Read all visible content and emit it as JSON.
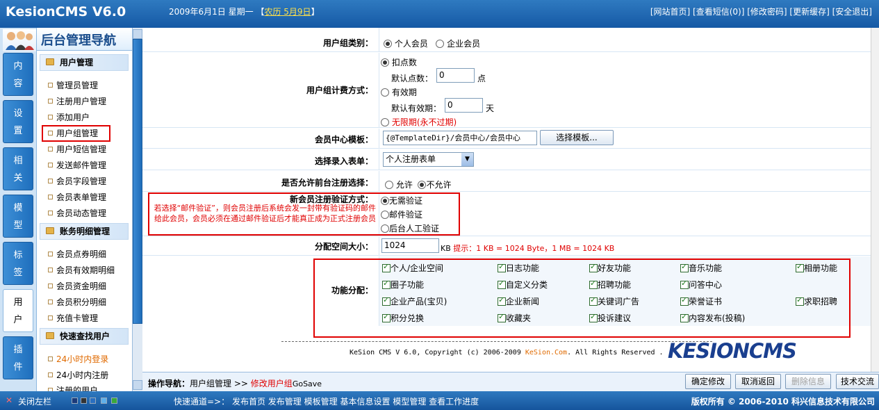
{
  "header": {
    "logo": "KesionCMS V6.0",
    "date": "2009年6月1日 星期一",
    "lunar_prefix": "【",
    "lunar": "农历 5月9日",
    "lunar_suffix": "】",
    "links": [
      "[网站首页]",
      "[查看短信(0)]",
      "[修改密码]",
      "[更新缓存]",
      "[安全退出]"
    ]
  },
  "left_tabs": [
    "内\n容",
    "设\n置",
    "相\n关",
    "模\n型",
    "标\n签",
    "用\n户",
    "插\n件"
  ],
  "nav": {
    "title": "后台管理导航",
    "section1": "用户管理",
    "items1": [
      "管理员管理",
      "注册用户管理",
      "添加用户",
      "用户组管理",
      "用户短信管理",
      "发送邮件管理",
      "会员字段管理",
      "会员表单管理",
      "会员动态管理"
    ],
    "section2": "账务明细管理",
    "items2": [
      "会员点券明细",
      "会员有效期明细",
      "会员资金明细",
      "会员积分明细",
      "充值卡管理"
    ],
    "section3": "快速查找用户",
    "items3": [
      "24小时内登录",
      "24小时内注册",
      "注册的用户"
    ]
  },
  "form": {
    "group_type_label": "用户组类别：",
    "group_type_opt1": "个人会员",
    "group_type_opt2": "企业会员",
    "billing_label": "用户组计费方式：",
    "billing_opt1": "扣点数",
    "default_points_label": "默认点数：",
    "default_points_value": "0",
    "points_unit": "点",
    "billing_opt2": "有效期",
    "default_period_label": "默认有效期：",
    "default_period_value": "0",
    "period_unit": "天",
    "billing_opt3": "无限期(永不过期)",
    "template_label": "会员中心模板：",
    "template_value": "{@TemplateDir}/会员中心/会员中心",
    "template_button": "选择模板...",
    "entry_form_label": "选择录入表单：",
    "entry_form_value": "个人注册表单",
    "allow_register_label": "是否允许前台注册选择：",
    "allow_opt1": "允许",
    "allow_opt2": "不允许",
    "verify_label": "新会员注册验证方式：",
    "verify_note": "若选择“邮件验证”，则会员注册后系统会发一封带有验证码的邮件给此会员，会员必须在通过邮件验证后才能真正成为正式注册会员",
    "verify_opt1": "无需验证",
    "verify_opt2": "邮件验证",
    "verify_opt3": "后台人工验证",
    "space_label": "分配空间大小：",
    "space_value": "1024",
    "space_unit": "KB",
    "space_hint": "提示：1 KB = 1024 Byte，1 MB = 1024 KB",
    "func_label": "功能分配：",
    "funcs": [
      [
        "个人/企业空间",
        "日志功能",
        "好友功能",
        "音乐功能",
        "相册功能"
      ],
      [
        "圈子功能",
        "自定义分类",
        "招聘功能",
        "问答中心",
        ""
      ],
      [
        "企业产品(宝贝)",
        "企业新闻",
        "关键词广告",
        "荣誉证书",
        "求职招聘"
      ],
      [
        "积分兑换",
        "收藏夹",
        "投诉建议",
        "内容发布(投稿)",
        ""
      ]
    ]
  },
  "copyright": {
    "text_before": "KeSion CMS V 6.0, Copyright (c) 2006-2009 ",
    "link": "KeSion.Com",
    "text_after": ". All Rights Reserved .",
    "brand": "KESIONCMS"
  },
  "opbar": {
    "label": "操作导航：",
    "crumb1": "用户组管理",
    "sep": ">>",
    "crumb2": "修改用户组",
    "suffix": "GoSave",
    "buttons": [
      "确定修改",
      "取消返回",
      "删除信息",
      "技术交流"
    ]
  },
  "footer": {
    "close_label": "关闭左栏",
    "quick_label": "快速通道=>：",
    "quick_links": [
      "发布首页",
      "发布管理",
      "模板管理",
      "基本信息设置",
      "模型管理",
      "查看工作进度"
    ],
    "copyright": "版权所有 © 2006-2010 科兴信息技术有限公司"
  },
  "colors": {
    "header_blue": "#1f6cb8",
    "accent_red": "#e00000",
    "link_orange": "#e06a00"
  }
}
